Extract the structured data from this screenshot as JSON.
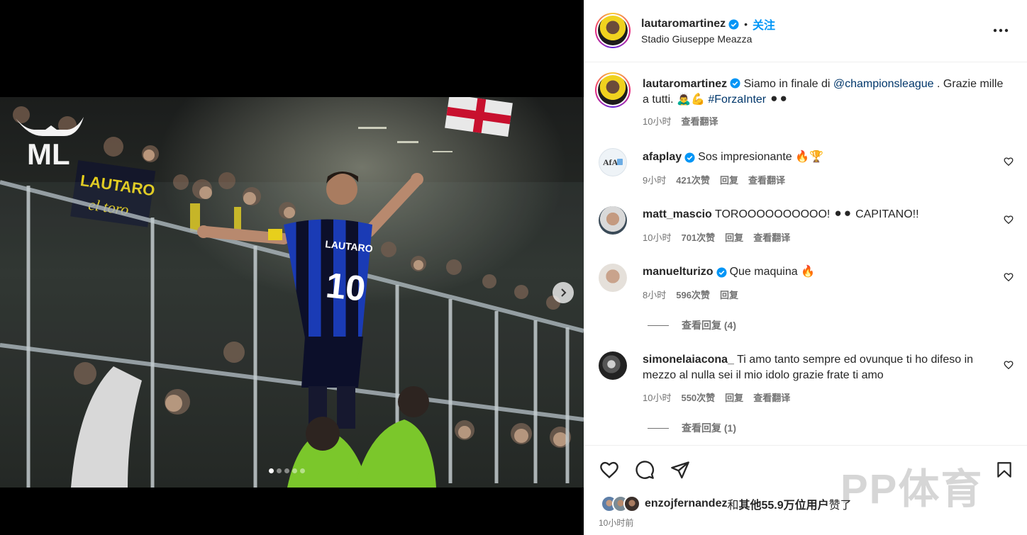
{
  "post": {
    "username": "lautaromartinez",
    "follow_separator": "•",
    "follow_label": "关注",
    "location": "Stadio Giuseppe Meazza",
    "more_label": "•••"
  },
  "caption": {
    "username": "lautaromartinez",
    "text_a": " Siamo in finale di ",
    "mention": "@championsleague",
    "text_b": " . Grazie mille a tutti. 🙇‍♂️💪 ",
    "hashtag": "#ForzaInter",
    "text_c": " ⚫⚫",
    "time": "10小时",
    "translate": "查看翻译"
  },
  "comments": [
    {
      "username": "afaplay",
      "verified": true,
      "text": "Sos impresionante 🔥🏆",
      "time": "9小时",
      "likes": "421次赞",
      "reply": "回复",
      "translate": "查看翻译"
    },
    {
      "username": "matt_mascio",
      "verified": false,
      "text": "TOROOOOOOOOOO! ⚫⚫ CAPITANO!!",
      "time": "10小时",
      "likes": "701次赞",
      "reply": "回复",
      "translate": "查看翻译"
    },
    {
      "username": "manuelturizo",
      "verified": true,
      "text": "Que maquina 🔥",
      "time": "8小时",
      "likes": "596次赞",
      "reply": "回复",
      "view_replies": "查看回复 (4)"
    },
    {
      "username": "simonelaiacona_",
      "verified": false,
      "text": "Ti amo tanto sempre ed ovunque ti ho difeso in mezzo al nulla sei il mio idolo grazie frate ti amo",
      "time": "10小时",
      "likes": "550次赞",
      "reply": "回复",
      "translate": "查看翻译",
      "view_replies": "查看回复 (1)"
    }
  ],
  "likes_line": {
    "user": "enzojfernandez",
    "connector": "和",
    "rest": "其他55.9万位用户",
    "suffix": "赞了"
  },
  "post_time": "10小时前",
  "watermark": "PP体育",
  "photo": {
    "logo_text": "ML",
    "banner_text": "LAUTARO el toro",
    "jersey_name": "LAUTARO",
    "jersey_number": "10"
  },
  "carousel": {
    "count": 5,
    "active": 1
  },
  "colors": {
    "follow_blue": "#0095f6",
    "verified_blue": "#0095f6",
    "inter_blue": "#1a3bb5"
  },
  "icons": [
    "verified-badge-icon",
    "heart-icon",
    "comment-icon",
    "share-icon",
    "bookmark-icon",
    "chevron-right-icon",
    "more-icon"
  ]
}
